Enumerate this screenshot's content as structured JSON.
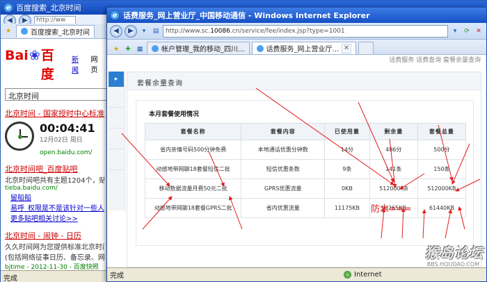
{
  "bg_window": {
    "title": "百度搜索_北京时间",
    "address": "http://ww",
    "tab_label": "百度搜索_北京时间",
    "baidu_logo_a": "Bai",
    "baidu_logo_b": "百度",
    "top_links": [
      "新闻",
      "网页"
    ],
    "search_value": "北京时间",
    "results": [
      {
        "title": "北京时间 - 国家授时中心标准",
        "time": "00:04:41",
        "date": "12月02日",
        "weekday": "周日",
        "url": "open.baidu.com/"
      },
      {
        "title": "北京时间吧_百度贴吧",
        "desc": "北京时间吧共有主题1204个，贴子57",
        "url": "tieba.baidu.com/",
        "links": [
          "留船船",
          "易呼_权限是不是该针对一些人呢"
        ],
        "more": "更多贴吧相关讨论>>"
      },
      {
        "title": "北京时间 - 闹钟 - 日历",
        "desc1": "久久时间网为您提供标准北京时间校",
        "desc2": "(包括网络征事日历、备忘录、网址收",
        "url": "bjtime - 2012-11-30 - 百度快照"
      }
    ],
    "status": "完成"
  },
  "fg_window": {
    "title": "话费服务_网上营业厅_中国移动通信 - Windows Internet Explorer",
    "address_prefix": "http://www.sc.",
    "address_domain": "10086",
    "address_suffix": ".cn/service/fee/index.jsp?type=1001",
    "tabs": [
      {
        "label": "帐户管理_我的移动_四川..."
      },
      {
        "label": "话费服务_网上营业厅..."
      }
    ],
    "top_links": "话费服务 话费查询 套餐余量查询",
    "left_tab": "▸",
    "panel_title": "套餐余量查询",
    "section_title": "本月套餐使用情况",
    "table": {
      "headers": [
        "套餐名称",
        "套餐内容",
        "已使用量",
        "剩余量",
        "套餐总量"
      ],
      "rows": [
        [
          "省内亲情号码500分钟免费",
          "本地通话优惠分钟数",
          "14分",
          "486分",
          "500分"
        ],
        [
          "动感地带网聊18套餐短信二批",
          "短信优惠条数",
          "9条",
          "141条",
          "150条"
        ],
        [
          "移动数据流量月费50元二批",
          "GPRS优惠流量",
          "0KB",
          "512000KB",
          "512000KB"
        ],
        [
          "动感地带网聊18套餐GPRS二批",
          "省内优惠流量",
          "11175KB",
          "50265KB",
          "61440KB"
        ]
      ]
    },
    "annotation": "防水===",
    "forum_logo": "猴岛论坛",
    "forum_url": "BBS.HOUDAO.COM",
    "status": "完成",
    "zone": "Internet"
  }
}
